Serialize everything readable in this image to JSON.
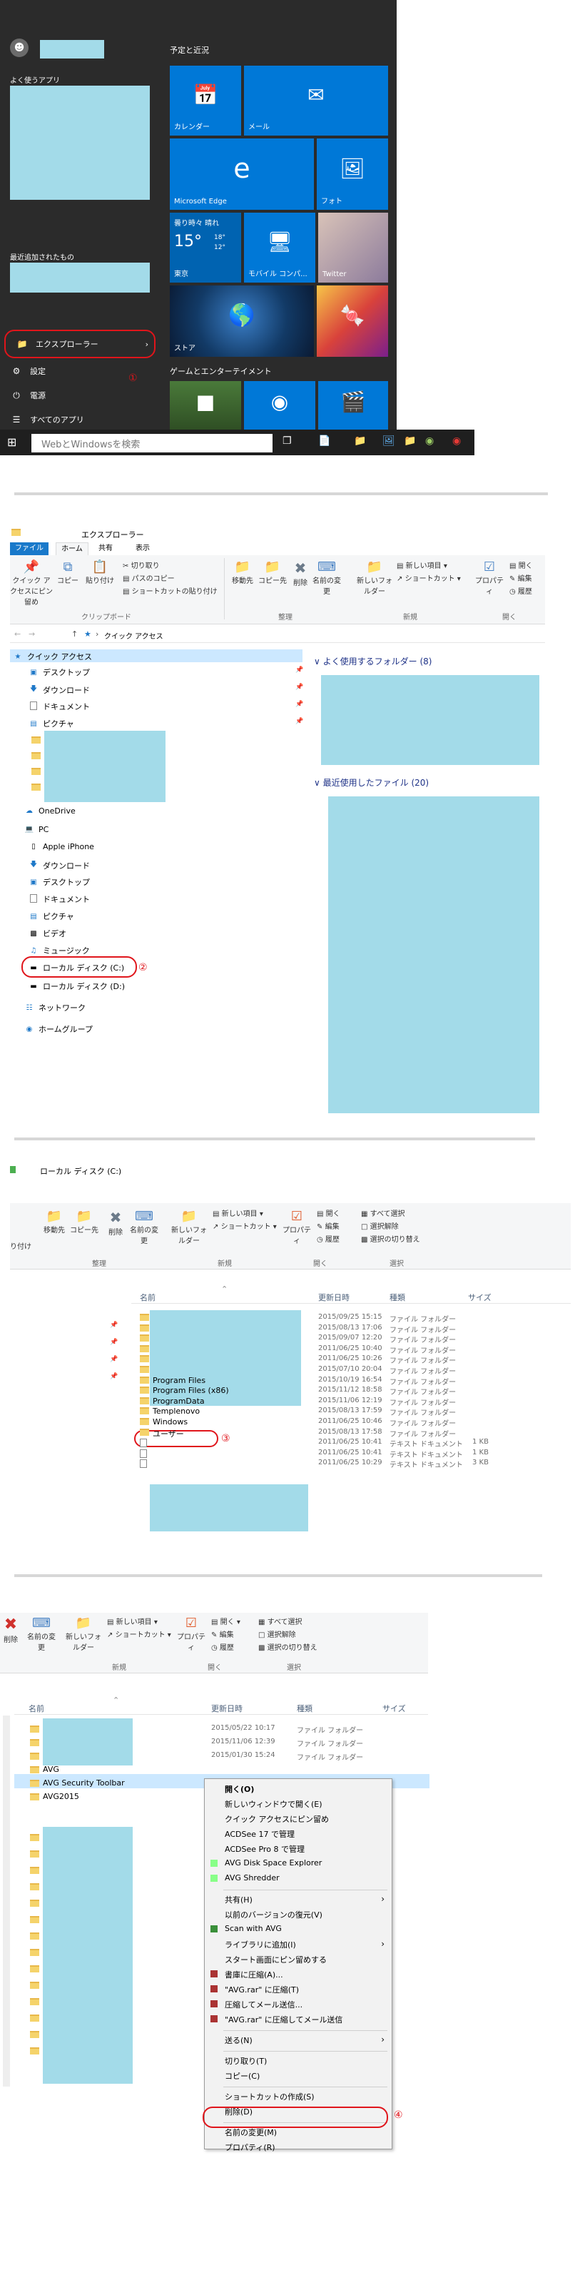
{
  "start_menu": {
    "frequent_label": "よく使うアプリ",
    "recent_label": "最近追加されたもの",
    "items": [
      "エクスプローラー",
      "設定",
      "電源",
      "すべてのアプリ"
    ],
    "annotation": "①",
    "group1_title": "予定と近況",
    "group2_title": "ゲームとエンターテイメント",
    "tiles": {
      "calendar": "カレンダー",
      "mail": "メール",
      "edge": "Microsoft Edge",
      "photos": "フォト",
      "weather_condition": "曇り時々 晴れ",
      "weather_temp": "15°",
      "weather_high": "18°",
      "weather_low": "12°",
      "weather_city": "東京",
      "mobile": "モバイル コンパ...",
      "twitter": "Twitter",
      "store": "ストア"
    },
    "search_placeholder": "WebとWindowsを検索"
  },
  "explorer1": {
    "title": "エクスプローラー",
    "tabs": [
      "ファイル",
      "ホーム",
      "共有",
      "表示"
    ],
    "ribbon": {
      "quick_access": "クイック アクセスにピン留め",
      "copy": "コピー",
      "paste": "貼り付け",
      "cut": "切り取り",
      "copy_path": "パスのコピー",
      "paste_shortcut": "ショートカットの貼り付け",
      "move_to": "移動先",
      "copy_to": "コピー先",
      "delete": "削除",
      "rename": "名前の変更",
      "new_folder": "新しいフォルダー",
      "new_item": "新しい項目",
      "shortcut": "ショートカット",
      "properties": "プロパティ",
      "open": "開く",
      "edit": "編集",
      "history": "履歴",
      "groups": [
        "クリップボード",
        "整理",
        "新規",
        "開く"
      ]
    },
    "address": "クイック アクセス",
    "tree": {
      "quick_access": "クイック アクセス",
      "desktop": "デスクトップ",
      "downloads": "ダウンロード",
      "documents": "ドキュメント",
      "pictures": "ピクチャ",
      "onedrive": "OneDrive",
      "pc": "PC",
      "iphone": "Apple iPhone",
      "pc_downloads": "ダウンロード",
      "pc_desktop": "デスクトップ",
      "pc_documents": "ドキュメント",
      "pc_pictures": "ピクチャ",
      "videos": "ビデオ",
      "music": "ミュージック",
      "local_c": "ローカル ディスク (C:)",
      "local_d": "ローカル ディスク (D:)",
      "network": "ネットワーク",
      "homegroup": "ホームグループ"
    },
    "frequent_header": "よく使用するフォルダー (8)",
    "recent_header": "最近使用したファイル (20)",
    "annotation": "②"
  },
  "explorer2": {
    "title": "ローカル ディスク (C:)",
    "ribbon": {
      "paste_partial": "り付け",
      "move_to": "移動先",
      "copy_to": "コピー先",
      "delete": "削除",
      "rename": "名前の変更",
      "new_folder": "新しいフォルダー",
      "new_item": "新しい項目",
      "shortcut": "ショートカット",
      "properties": "プロパティ",
      "open": "開く",
      "edit": "編集",
      "history": "履歴",
      "select_all": "すべて選択",
      "select_none": "選択解除",
      "invert": "選択の切り替え",
      "groups": [
        "整理",
        "新規",
        "開く",
        "選択"
      ]
    },
    "columns": [
      "名前",
      "更新日時",
      "種類",
      "サイズ"
    ],
    "rows": [
      {
        "name": "",
        "date": "2015/09/25 15:15",
        "type": "ファイル フォルダー",
        "size": ""
      },
      {
        "name": "",
        "date": "2015/08/13 17:06",
        "type": "ファイル フォルダー",
        "size": ""
      },
      {
        "name": "",
        "date": "2015/09/07 12:20",
        "type": "ファイル フォルダー",
        "size": ""
      },
      {
        "name": "",
        "date": "2011/06/25 10:40",
        "type": "ファイル フォルダー",
        "size": ""
      },
      {
        "name": "",
        "date": "2011/06/25 10:26",
        "type": "ファイル フォルダー",
        "size": ""
      },
      {
        "name": "",
        "date": "2015/07/10 20:04",
        "type": "ファイル フォルダー",
        "size": ""
      },
      {
        "name": "Program Files",
        "date": "2015/10/19 16:54",
        "type": "ファイル フォルダー",
        "size": ""
      },
      {
        "name": "Program Files (x86)",
        "date": "2015/11/12 18:58",
        "type": "ファイル フォルダー",
        "size": ""
      },
      {
        "name": "ProgramData",
        "date": "2015/11/06 12:19",
        "type": "ファイル フォルダー",
        "size": ""
      },
      {
        "name": "Templenovo",
        "date": "2015/08/13 17:59",
        "type": "ファイル フォルダー",
        "size": ""
      },
      {
        "name": "Windows",
        "date": "2011/06/25 10:46",
        "type": "ファイル フォルダー",
        "size": ""
      },
      {
        "name": "ユーザー",
        "date": "2015/08/13 17:58",
        "type": "ファイル フォルダー",
        "size": ""
      },
      {
        "name": "",
        "date": "2011/06/25 10:41",
        "type": "テキスト ドキュメント",
        "size": "1 KB"
      },
      {
        "name": "",
        "date": "2011/06/25 10:41",
        "type": "テキスト ドキュメント",
        "size": "1 KB"
      },
      {
        "name": "",
        "date": "2011/06/25 10:29",
        "type": "テキスト ドキュメント",
        "size": "3 KB"
      }
    ],
    "annotation": "③"
  },
  "explorer3": {
    "ribbon": {
      "delete": "削除",
      "rename": "名前の変更",
      "new_folder": "新しいフォルダー",
      "new_item": "新しい項目",
      "shortcut": "ショートカット",
      "properties": "プロパティ",
      "open": "開く",
      "edit": "編集",
      "history": "履歴",
      "select_all": "すべて選択",
      "select_none": "選択解除",
      "invert": "選択の切り替え",
      "groups": [
        "新規",
        "開く",
        "選択"
      ]
    },
    "columns": [
      "名前",
      "更新日時",
      "種類",
      "サイズ"
    ],
    "rows": [
      {
        "name": "",
        "date": "2015/05/22 10:17",
        "type": "ファイル フォルダー"
      },
      {
        "name": "",
        "date": "2015/11/06 12:39",
        "type": "ファイル フォルダー"
      },
      {
        "name": "",
        "date": "2015/01/30 15:24",
        "type": "ファイル フォルダー"
      },
      {
        "name": "AVG",
        "date": "",
        "type": ""
      },
      {
        "name": "AVG Security Toolbar",
        "date": "",
        "type": ""
      },
      {
        "name": "AVG2015",
        "date": "",
        "type": ""
      }
    ],
    "context_menu": [
      "開く(O)",
      "新しいウィンドウで開く(E)",
      "クイック アクセスにピン留め",
      "ACDSee 17 で管理",
      "ACDSee Pro 8 で管理",
      "AVG Disk Space Explorer",
      "AVG Shredder",
      "共有(H)",
      "以前のバージョンの復元(V)",
      "Scan with AVG",
      "ライブラリに追加(I)",
      "スタート画面にピン留めする",
      "書庫に圧縮(A)...",
      "\"AVG.rar\" に圧縮(T)",
      "圧縮してメール送信...",
      "\"AVG.rar\" に圧縮してメール送信",
      "送る(N)",
      "切り取り(T)",
      "コピー(C)",
      "ショートカットの作成(S)",
      "削除(D)",
      "名前の変更(M)",
      "プロパティ(R)"
    ],
    "annotation": "④"
  }
}
